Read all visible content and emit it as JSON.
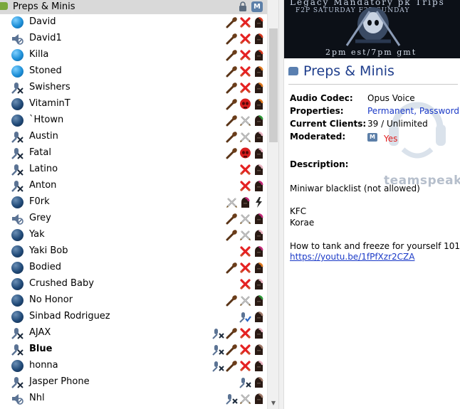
{
  "channel": {
    "name": "Preps & Minis"
  },
  "users": [
    {
      "name": "David",
      "status": "blue",
      "bold": false,
      "icons": [
        "club",
        "x",
        "helm-red"
      ]
    },
    {
      "name": "David1",
      "status": "spk-muted",
      "bold": false,
      "icons": [
        "club",
        "x",
        "helm-red"
      ]
    },
    {
      "name": "Killa",
      "status": "blue",
      "bold": false,
      "icons": [
        "club",
        "x",
        "helm-red"
      ]
    },
    {
      "name": "Stoned",
      "status": "blue",
      "bold": false,
      "icons": [
        "club",
        "x",
        "helm-orange"
      ]
    },
    {
      "name": "Swishers",
      "status": "mic-muted",
      "bold": false,
      "icons": [
        "club",
        "x",
        "helm-orange"
      ]
    },
    {
      "name": "VitaminT",
      "status": "dark",
      "bold": false,
      "icons": [
        "club",
        "skull",
        "helm-orange"
      ]
    },
    {
      "name": "`Htown",
      "status": "dark",
      "bold": false,
      "icons": [
        "club",
        "swords",
        "helm-green"
      ]
    },
    {
      "name": "Austin",
      "status": "mic-muted",
      "bold": false,
      "icons": [
        "club",
        "swords",
        "helm-pink"
      ]
    },
    {
      "name": "Fatal",
      "status": "mic-muted",
      "bold": false,
      "icons": [
        "club",
        "skull",
        "helm-pink"
      ]
    },
    {
      "name": "Latino",
      "status": "mic-muted",
      "bold": false,
      "icons": [
        "x",
        "helm-pink"
      ]
    },
    {
      "name": "Anton",
      "status": "mic-muted",
      "bold": false,
      "icons": [
        "x",
        "helm-magenta"
      ]
    },
    {
      "name": "F0rk",
      "status": "dark",
      "bold": false,
      "icons": [
        "swords",
        "helm-magenta",
        "bolt"
      ]
    },
    {
      "name": "Grey",
      "status": "spk-muted",
      "bold": false,
      "icons": [
        "club",
        "swords",
        "helm-magenta"
      ]
    },
    {
      "name": "Yak",
      "status": "dark",
      "bold": false,
      "icons": [
        "club",
        "swords",
        "helm-pink"
      ]
    },
    {
      "name": "Yaki Bob",
      "status": "dark",
      "bold": false,
      "icons": [
        "x",
        "helm-magenta"
      ]
    },
    {
      "name": "Bodied",
      "status": "dark",
      "bold": false,
      "icons": [
        "club",
        "x",
        "helm-orange"
      ]
    },
    {
      "name": "Crushed Baby",
      "status": "dark",
      "bold": false,
      "icons": [
        "x",
        "helm-pink"
      ]
    },
    {
      "name": "No Honor",
      "status": "dark",
      "bold": false,
      "icons": [
        "club",
        "swords",
        "helm-green"
      ]
    },
    {
      "name": "Sinbad Rodriguez",
      "status": "dark",
      "bold": false,
      "icons": [
        "mic-check",
        "helm-brown"
      ]
    },
    {
      "name": "AJAX",
      "status": "mic-muted",
      "bold": false,
      "icons": [
        "mic-x",
        "club",
        "x",
        "helm-pink"
      ]
    },
    {
      "name": "Blue",
      "status": "mic-muted",
      "bold": true,
      "icons": [
        "mic-x",
        "club",
        "x",
        "helm-brown"
      ]
    },
    {
      "name": "honna",
      "status": "dark",
      "bold": false,
      "icons": [
        "mic-x",
        "club",
        "x",
        "helm-pink"
      ]
    },
    {
      "name": "Jasper Phone",
      "status": "mic-muted",
      "bold": false,
      "icons": [
        "mic-x",
        "helm-brown"
      ]
    },
    {
      "name": "Nhl",
      "status": "spk-muted",
      "bold": false,
      "icons": [
        "mic-x",
        "swords",
        "helm-brown"
      ]
    }
  ],
  "banner": {
    "line1": "Legacy Mandatory pk Trips",
    "line2": "F2P SATURDAY     F2P SUNDAY",
    "line3": "2pm est/7pm gmt"
  },
  "info": {
    "title": "Preps & Minis",
    "audio_codec_label": "Audio Codec:",
    "audio_codec_value": "Opus Voice",
    "properties_label": "Properties:",
    "properties_value": "Permanent, Password",
    "clients_label": "Current Clients:",
    "clients_value": "39 / Unlimited",
    "moderated_label": "Moderated:",
    "moderated_value": "Yes",
    "description_label": "Description:",
    "desc_line1": "Miniwar blacklist (not allowed)",
    "desc_line2": "KFC",
    "desc_line3": "Korae",
    "desc_line4": "How to tank and freeze for yourself 101:",
    "desc_link": "https://youtu.be/1fPfXzr2CZA",
    "watermark": "teamspeak"
  },
  "colors": {
    "title_blue": "#1f3e8c",
    "link_blue": "#1a39c7",
    "red": "#e21b1b"
  }
}
